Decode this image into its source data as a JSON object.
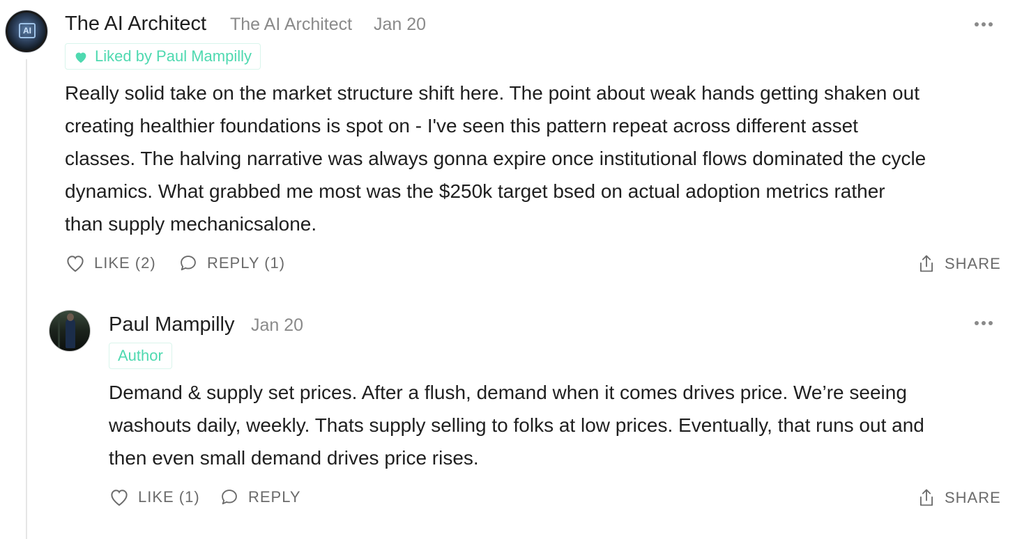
{
  "comment": {
    "author": "The AI Architect",
    "handle": "The AI Architect",
    "date": "Jan 20",
    "liked_by": "Liked by Paul Mampilly",
    "lines": [
      "Really solid take on the market structure shift here. The point about weak hands getting shaken out",
      "creating healthier foundations is spot on - I've seen this pattern repeat across different asset",
      "classes. The halving narrative was always gonna expire once institutional flows dominated the cycle",
      "dynamics. What grabbed me most was the $250k target bsed on actual adoption metrics rather",
      "than supply mechanicsalone."
    ],
    "like_label": "LIKE (2)",
    "reply_label": "REPLY (1)",
    "share_label": "SHARE",
    "avatar_icon": "AI"
  },
  "reply": {
    "author": "Paul Mampilly",
    "date": "Jan 20",
    "badge": "Author",
    "lines": [
      "Demand & supply set prices. After a flush, demand when it comes drives price. We’re seeing",
      "washouts daily, weekly. Thats supply selling to folks at low prices. Eventually, that runs out and",
      "then even small demand drives price rises."
    ],
    "like_label": "LIKE (1)",
    "reply_label": "REPLY",
    "share_label": "SHARE"
  },
  "colors": {
    "accent": "#4fd9b0",
    "muted": "#8a8a8a",
    "text": "#1f1f1f"
  }
}
